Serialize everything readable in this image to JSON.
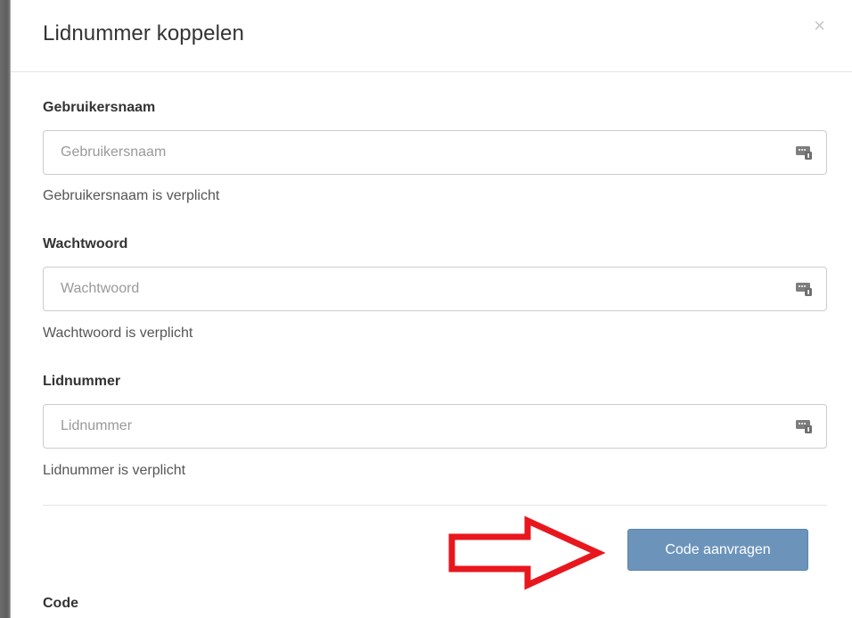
{
  "modal": {
    "title": "Lidnummer koppelen",
    "close_label": "×"
  },
  "fields": [
    {
      "label": "Gebruikersnaam",
      "placeholder": "Gebruikersnaam",
      "value": "",
      "help": "Gebruikersnaam is verplicht",
      "icon": "password-manager-icon"
    },
    {
      "label": "Wachtwoord",
      "placeholder": "Wachtwoord",
      "value": "",
      "help": "Wachtwoord is verplicht",
      "icon": "password-manager-icon"
    },
    {
      "label": "Lidnummer",
      "placeholder": "Lidnummer",
      "value": "",
      "help": "Lidnummer is verplicht",
      "icon": "password-manager-icon"
    }
  ],
  "actions": {
    "request_code_label": "Code aanvragen"
  },
  "annotation": {
    "arrow_color": "#e8171e",
    "arrow_icon": "red-arrow-right-icon"
  },
  "code_section": {
    "label": "Code"
  },
  "colors": {
    "button_bg": "#6c94bb",
    "close": "#c7c7c7"
  }
}
